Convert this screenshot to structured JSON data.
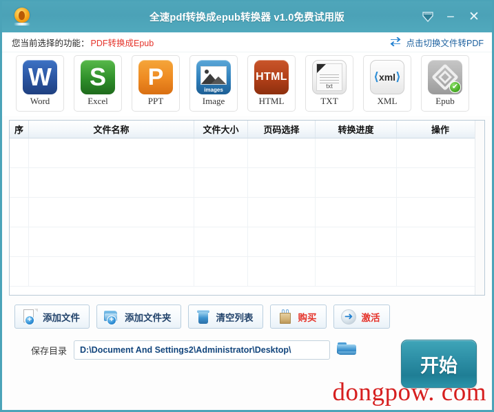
{
  "window": {
    "title": "全速pdf转换成epub转换器 v1.0免费试用版",
    "logo_icon": "flame-logo-icon",
    "controls": {
      "shield": "shield-down-icon",
      "minimize": "−",
      "close": "✕"
    },
    "accent_color": "#4ba3b8"
  },
  "function_bar": {
    "label": "您当前选择的功能：",
    "value": "PDF转换成Epub",
    "value_color": "#e5332a",
    "switch_link": {
      "icon": "swap-arrows-icon",
      "label": "点击切换文件转PDF",
      "color": "#1a5f9e"
    }
  },
  "formats": [
    {
      "caption": "Word",
      "glyph": "W",
      "icon": "word-format-icon",
      "selected": false
    },
    {
      "caption": "Excel",
      "glyph": "S",
      "icon": "excel-format-icon",
      "selected": false
    },
    {
      "caption": "PPT",
      "glyph": "P",
      "icon": "ppt-format-icon",
      "selected": false
    },
    {
      "caption": "Image",
      "glyph": "images",
      "icon": "image-format-icon",
      "selected": false
    },
    {
      "caption": "HTML",
      "glyph": "HTML",
      "icon": "html-format-icon",
      "selected": false
    },
    {
      "caption": "TXT",
      "glyph": "txt",
      "icon": "txt-format-icon",
      "selected": false
    },
    {
      "caption": "XML",
      "glyph": "xml",
      "icon": "xml-format-icon",
      "selected": false
    },
    {
      "caption": "Epub",
      "glyph": "epub",
      "icon": "epub-format-icon",
      "selected": true,
      "badge": "✔"
    }
  ],
  "table": {
    "columns": [
      "序",
      "文件名称",
      "文件大小",
      "页码选择",
      "转换进度",
      "操作"
    ],
    "rows": [],
    "empty_row_count": 5
  },
  "actions": [
    {
      "label": "添加文件",
      "icon": "add-file-icon",
      "red": false
    },
    {
      "label": "添加文件夹",
      "icon": "add-folder-icon",
      "red": false
    },
    {
      "label": "清空列表",
      "icon": "clear-list-icon",
      "red": false
    },
    {
      "label": "购买",
      "icon": "purchase-icon",
      "red": true
    },
    {
      "label": "激活",
      "icon": "activate-icon",
      "red": true
    }
  ],
  "save": {
    "label": "保存目录",
    "path": "D:\\Document And Settings2\\Administrator\\Desktop\\",
    "browse_icon": "open-folder-icon"
  },
  "start_button": {
    "label": "开始",
    "color": "#2d8fa6"
  },
  "watermark": {
    "text": "dongpow. com",
    "color": "#d61f1f"
  }
}
